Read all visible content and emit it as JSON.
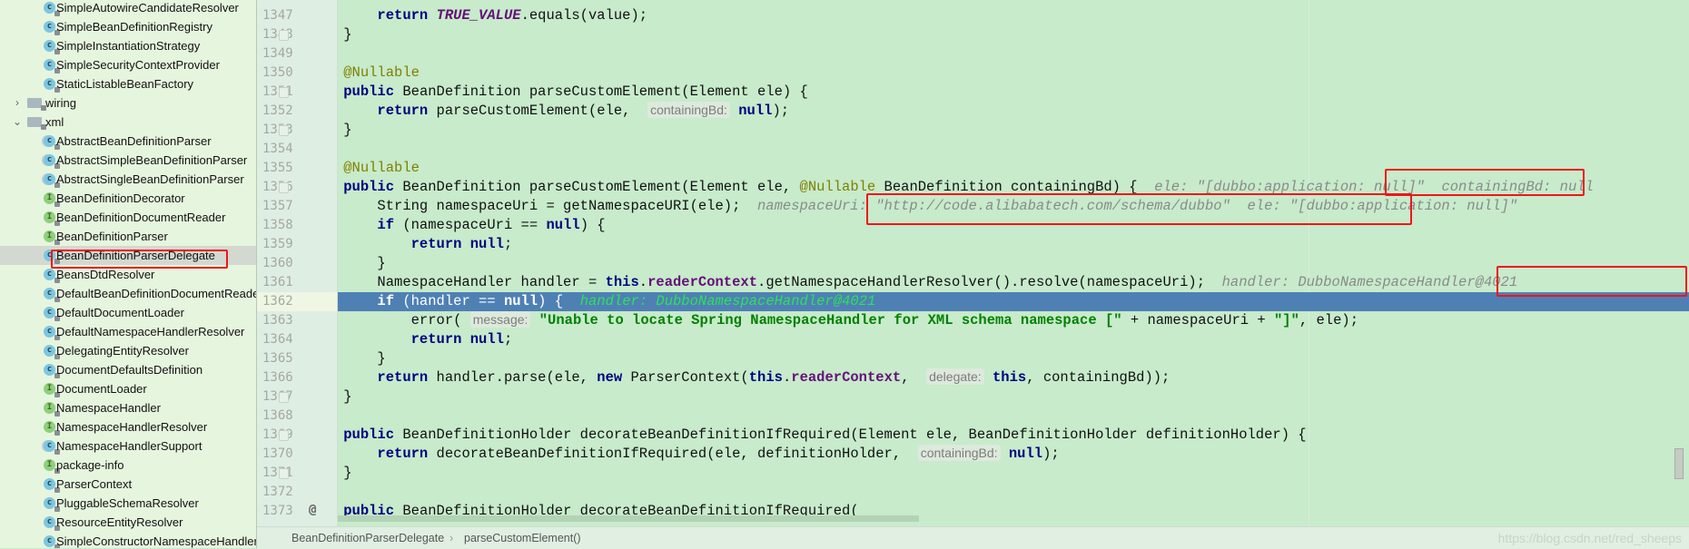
{
  "sidebar": {
    "items": [
      {
        "label": "SimpleAutowireCandidateResolver",
        "type": "class",
        "depth": 2
      },
      {
        "label": "SimpleBeanDefinitionRegistry",
        "type": "class",
        "depth": 2
      },
      {
        "label": "SimpleInstantiationStrategy",
        "type": "class",
        "depth": 2
      },
      {
        "label": "SimpleSecurityContextProvider",
        "type": "class",
        "depth": 2
      },
      {
        "label": "StaticListableBeanFactory",
        "type": "class",
        "depth": 2
      },
      {
        "label": "wiring",
        "type": "folder",
        "depth": 1,
        "expanded": false
      },
      {
        "label": "xml",
        "type": "folder",
        "depth": 1,
        "expanded": true
      },
      {
        "label": "AbstractBeanDefinitionParser",
        "type": "abstract",
        "depth": 2
      },
      {
        "label": "AbstractSimpleBeanDefinitionParser",
        "type": "abstract",
        "depth": 2
      },
      {
        "label": "AbstractSingleBeanDefinitionParser",
        "type": "abstract",
        "depth": 2
      },
      {
        "label": "BeanDefinitionDecorator",
        "type": "iface",
        "depth": 2
      },
      {
        "label": "BeanDefinitionDocumentReader",
        "type": "iface",
        "depth": 2
      },
      {
        "label": "BeanDefinitionParser",
        "type": "iface",
        "depth": 2
      },
      {
        "label": "BeanDefinitionParserDelegate",
        "type": "class",
        "depth": 2,
        "selected": true
      },
      {
        "label": "BeansDtdResolver",
        "type": "class",
        "depth": 2
      },
      {
        "label": "DefaultBeanDefinitionDocumentReader",
        "type": "class",
        "depth": 2
      },
      {
        "label": "DefaultDocumentLoader",
        "type": "class",
        "depth": 2
      },
      {
        "label": "DefaultNamespaceHandlerResolver",
        "type": "class",
        "depth": 2
      },
      {
        "label": "DelegatingEntityResolver",
        "type": "class",
        "depth": 2
      },
      {
        "label": "DocumentDefaultsDefinition",
        "type": "class",
        "depth": 2
      },
      {
        "label": "DocumentLoader",
        "type": "iface",
        "depth": 2
      },
      {
        "label": "NamespaceHandler",
        "type": "iface",
        "depth": 2
      },
      {
        "label": "NamespaceHandlerResolver",
        "type": "iface",
        "depth": 2
      },
      {
        "label": "NamespaceHandlerSupport",
        "type": "abstract",
        "depth": 2
      },
      {
        "label": "package-info",
        "type": "iface",
        "depth": 2
      },
      {
        "label": "ParserContext",
        "type": "class",
        "depth": 2
      },
      {
        "label": "PluggableSchemaResolver",
        "type": "class",
        "depth": 2
      },
      {
        "label": "ResourceEntityResolver",
        "type": "class",
        "depth": 2
      },
      {
        "label": "SimpleConstructorNamespaceHandler",
        "type": "class",
        "depth": 2
      }
    ]
  },
  "editor": {
    "current_line": "1362",
    "lines": [
      {
        "n": "1347",
        "tokens": [
          [
            "",
            "        "
          ],
          [
            "kw",
            "return "
          ],
          [
            "const",
            "TRUE_VALUE"
          ],
          [
            "",
            ".equals(value);"
          ]
        ]
      },
      {
        "n": "1348",
        "tokens": [
          [
            "",
            "    }"
          ]
        ]
      },
      {
        "n": "1349",
        "tokens": []
      },
      {
        "n": "1350",
        "tokens": [
          [
            "",
            "    "
          ],
          [
            "ann",
            "@Nullable"
          ]
        ]
      },
      {
        "n": "1351",
        "tokens": [
          [
            "",
            "    "
          ],
          [
            "kw",
            "public "
          ],
          [
            "",
            "BeanDefinition parseCustomElement(Element ele) {"
          ]
        ]
      },
      {
        "n": "1352",
        "tokens": [
          [
            "",
            "        "
          ],
          [
            "kw",
            "return "
          ],
          [
            "",
            "parseCustomElement(ele,  "
          ],
          [
            "hint",
            "containingBd:"
          ],
          [
            "kw",
            " null"
          ],
          [
            "",
            ");"
          ]
        ]
      },
      {
        "n": "1353",
        "tokens": [
          [
            "",
            "    }"
          ]
        ]
      },
      {
        "n": "1354",
        "tokens": []
      },
      {
        "n": "1355",
        "tokens": [
          [
            "",
            "    "
          ],
          [
            "ann",
            "@Nullable"
          ]
        ]
      },
      {
        "n": "1356",
        "tokens": [
          [
            "",
            "    "
          ],
          [
            "kw",
            "public "
          ],
          [
            "",
            "BeanDefinition parseCustomElement(Element ele, "
          ],
          [
            "ann",
            "@Nullable"
          ],
          [
            "",
            " BeanDefinition containingBd) {  "
          ],
          [
            "dbg",
            "ele: \"[dubbo:application: null]\"  containingBd: null"
          ]
        ]
      },
      {
        "n": "1357",
        "tokens": [
          [
            "",
            "        String namespaceUri = getNamespaceURI(ele);  "
          ],
          [
            "dbg",
            "namespaceUri: \"http://code.alibabatech.com/schema/dubbo\"  ele: \"[dubbo:application: null]\""
          ]
        ]
      },
      {
        "n": "1358",
        "tokens": [
          [
            "",
            "        "
          ],
          [
            "kw",
            "if "
          ],
          [
            "",
            "(namespaceUri == "
          ],
          [
            "kw",
            "null"
          ],
          [
            "",
            ") {"
          ]
        ]
      },
      {
        "n": "1359",
        "tokens": [
          [
            "",
            "            "
          ],
          [
            "kw",
            "return null"
          ],
          [
            "",
            ";"
          ]
        ]
      },
      {
        "n": "1360",
        "tokens": [
          [
            "",
            "        }"
          ]
        ]
      },
      {
        "n": "1361",
        "tokens": [
          [
            "",
            "        NamespaceHandler handler = "
          ],
          [
            "kw",
            "this"
          ],
          [
            "",
            "."
          ],
          [
            "field",
            "readerContext"
          ],
          [
            "",
            ".getNamespaceHandlerResolver().resolve(namespaceUri);  "
          ],
          [
            "dbg",
            "handler: DubboNamespaceHandler@4021"
          ]
        ]
      },
      {
        "n": "1362",
        "tokens": [
          [
            "",
            "        "
          ],
          [
            "kw",
            "if "
          ],
          [
            "",
            "(handler == "
          ],
          [
            "kw",
            "null"
          ],
          [
            "",
            ") {  "
          ],
          [
            "dbg",
            "handler: DubboNamespaceHandler@4021"
          ]
        ]
      },
      {
        "n": "1363",
        "tokens": [
          [
            "",
            "            error( "
          ],
          [
            "hint",
            "message:"
          ],
          [
            "str",
            " \"Unable to locate Spring NamespaceHandler for XML schema namespace [\""
          ],
          [
            "",
            " + namespaceUri + "
          ],
          [
            "str",
            "\"]\""
          ],
          [
            "",
            ", ele);"
          ]
        ]
      },
      {
        "n": "1364",
        "tokens": [
          [
            "",
            "            "
          ],
          [
            "kw",
            "return null"
          ],
          [
            "",
            ";"
          ]
        ]
      },
      {
        "n": "1365",
        "tokens": [
          [
            "",
            "        }"
          ]
        ]
      },
      {
        "n": "1366",
        "tokens": [
          [
            "",
            "        "
          ],
          [
            "kw",
            "return "
          ],
          [
            "",
            "handler.parse(ele, "
          ],
          [
            "kw",
            "new "
          ],
          [
            "",
            "ParserContext("
          ],
          [
            "kw",
            "this"
          ],
          [
            "",
            "."
          ],
          [
            "field",
            "readerContext"
          ],
          [
            "",
            ",  "
          ],
          [
            "hint",
            "delegate:"
          ],
          [
            "kw",
            " this"
          ],
          [
            "",
            ", containingBd));"
          ]
        ]
      },
      {
        "n": "1367",
        "tokens": [
          [
            "",
            "    }"
          ]
        ]
      },
      {
        "n": "1368",
        "tokens": []
      },
      {
        "n": "1369",
        "tokens": [
          [
            "",
            "    "
          ],
          [
            "kw",
            "public "
          ],
          [
            "",
            "BeanDefinitionHolder decorateBeanDefinitionIfRequired(Element ele, BeanDefinitionHolder definitionHolder) {"
          ]
        ]
      },
      {
        "n": "1370",
        "tokens": [
          [
            "",
            "        "
          ],
          [
            "kw",
            "return "
          ],
          [
            "",
            "decorateBeanDefinitionIfRequired(ele, definitionHolder,  "
          ],
          [
            "hint",
            "containingBd:"
          ],
          [
            "kw",
            " null"
          ],
          [
            "",
            ");"
          ]
        ]
      },
      {
        "n": "1371",
        "tokens": [
          [
            "",
            "    }"
          ]
        ]
      },
      {
        "n": "1372",
        "tokens": []
      },
      {
        "n": "1373",
        "tokens": [
          [
            "",
            "    "
          ],
          [
            "kw",
            "public "
          ],
          [
            "",
            "BeanDefinitionHolder decorateBeanDefinitionIfRequired("
          ]
        ],
        "marker": "@"
      }
    ]
  },
  "breadcrumb": {
    "items": [
      "BeanDefinitionParserDelegate",
      "parseCustomElement()"
    ],
    "separator": "›"
  },
  "watermark": "https://blog.csdn.net/red_sheeps",
  "colors": {
    "editor_bg": "#c7ebcb",
    "execution_line": "#4f80b4",
    "highlight_box": "#f0141c",
    "keyword": "#000080",
    "annotation": "#808000",
    "field": "#660e7a",
    "string": "#008000"
  }
}
